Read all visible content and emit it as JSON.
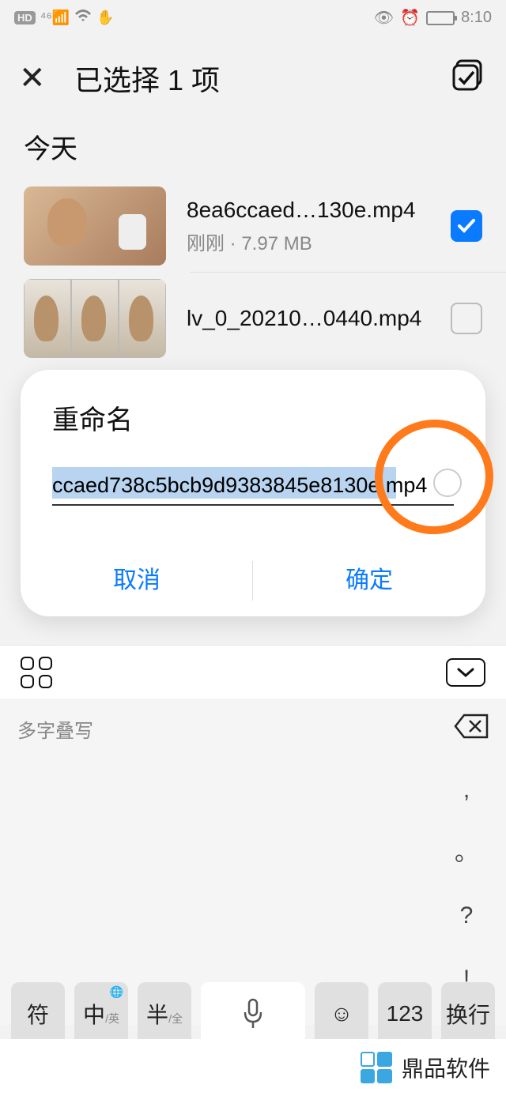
{
  "statusbar": {
    "hd": "HD",
    "time": "8:10"
  },
  "header": {
    "title": "已选择 1 项"
  },
  "section": "今天",
  "files": [
    {
      "name": "8ea6ccaed…130e.mp4",
      "meta": "刚刚 · 7.97 MB",
      "checked": true
    },
    {
      "name": "lv_0_20210…0440.mp4",
      "meta": "",
      "checked": false
    }
  ],
  "dialog": {
    "title": "重命名",
    "value": "ccaed738c5bcb9d9383845e8130e.mp4",
    "cancel": "取消",
    "confirm": "确定"
  },
  "keyboard": {
    "candidate_hint": "多字叠写",
    "puncts": [
      ",",
      "。",
      "?",
      "!"
    ],
    "bottom_keys": {
      "sym": "符",
      "lang_main": "中",
      "lang_sub": "/英",
      "width_main": "半",
      "width_sub": "/全",
      "num": "123",
      "enter": "换行"
    }
  },
  "watermark": "鼎品软件"
}
